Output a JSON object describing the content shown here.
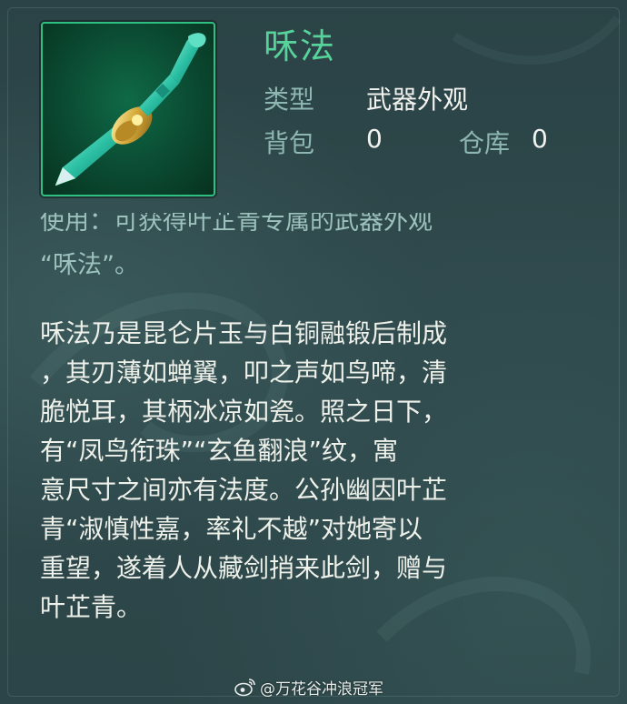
{
  "item": {
    "name": "咊法",
    "icon": "jade-flute-weapon-icon",
    "type_label": "类型",
    "type_value": "武器外观",
    "bag_label": "背包",
    "bag_value": "0",
    "storage_label": "仓库",
    "storage_value": "0"
  },
  "usage": {
    "line1": "使用：可获得叶芷青专属的武器外观",
    "line2": "“咊法”。"
  },
  "description": {
    "lines": [
      "咊法乃是昆仑片玉与白铜融锻后制成",
      "，其刃薄如蝉翼，叩之声如鸟啼，清",
      "脆悦耳，其柄冰凉如瓷。照之日下，",
      "有“凤鸟衔珠”“玄鱼翻浪”纹，寓",
      "意尺寸之间亦有法度。公孙幽因叶芷",
      "青“淑慎性嘉，率礼不越”对她寄以",
      "重望，遂着人从藏剑捎来此剑，赠与",
      "叶芷青。"
    ]
  },
  "watermark": {
    "logo": "weibo-logo-icon",
    "text": "@万花谷冲浪冠军"
  },
  "colors": {
    "title": "#56d29a",
    "label": "#8eb7b2",
    "value": "#f2f2ee",
    "frame": "#2fbf83"
  }
}
